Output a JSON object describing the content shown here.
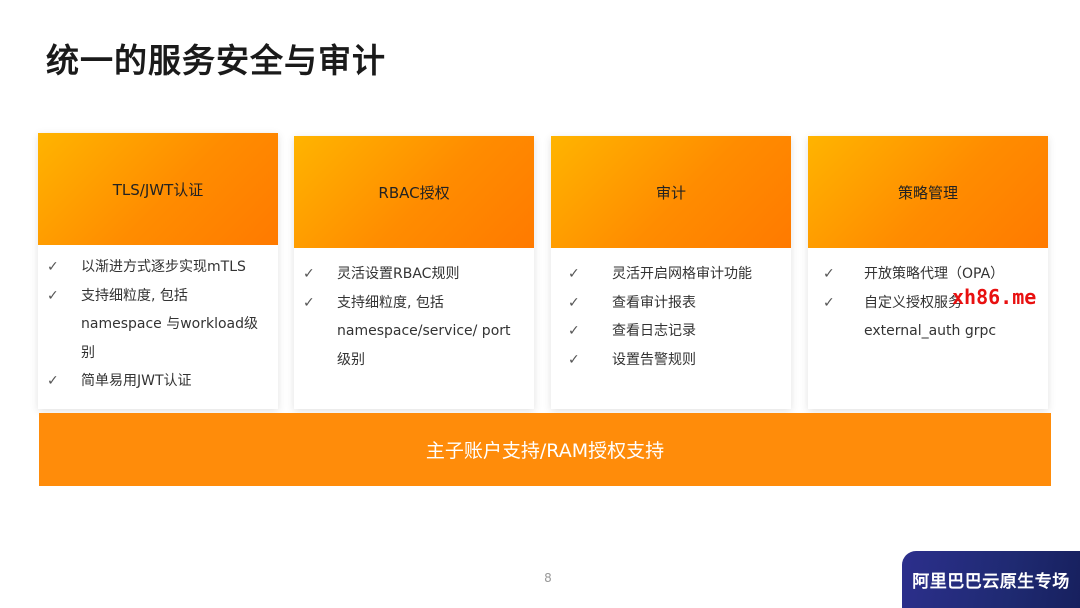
{
  "title": "统一的服务安全与审计",
  "cards": [
    {
      "header": "TLS/JWT认证",
      "items": [
        "以渐进方式逐步实现mTLS",
        "支持细粒度, 包括 namespace 与workload级别",
        "简单易用JWT认证"
      ]
    },
    {
      "header": "RBAC授权",
      "items": [
        "灵活设置RBAC规则",
        "支持细粒度, 包括 namespace/service/ port 级别"
      ]
    },
    {
      "header": "审计",
      "items": [
        "灵活开启网格审计功能",
        "查看审计报表",
        "查看日志记录",
        "设置告警规则"
      ]
    },
    {
      "header": "策略管理",
      "items": [
        "开放策略代理（OPA）",
        "自定义授权服务 external_auth grpc"
      ]
    }
  ],
  "check_glyph": "✓",
  "bottom_bar": "主子账户支持/RAM授权支持",
  "page_number": "8",
  "watermark": "xh86.me",
  "brand_badge": "阿里巴巴云原生专场",
  "colors": {
    "accent_orange": "#ff8c0a",
    "badge_navy": "#1f2a72",
    "watermark_red": "#e81010"
  }
}
